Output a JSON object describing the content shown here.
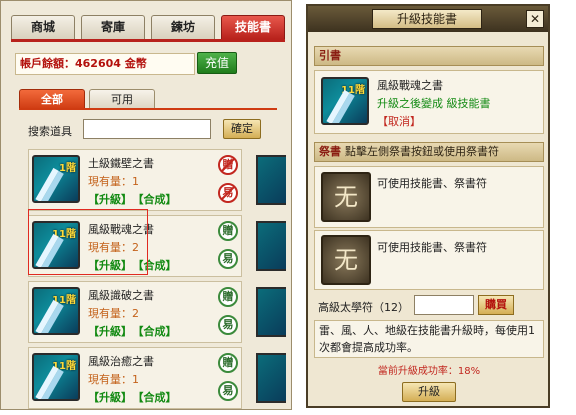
{
  "left": {
    "tabs": [
      "商城",
      "寄庫",
      "鍊坊",
      "技能書"
    ],
    "account_label": "帳戶餘額：462604 金幣",
    "recharge_label": "充值",
    "subtabs": [
      "全部",
      "可用"
    ],
    "search_label": "搜索道具",
    "search_value": "",
    "confirm_label": "確定",
    "items": [
      {
        "level": "1階",
        "name": "土級鐵壁之書",
        "qty": "現有量：1",
        "upgrade": "【升級】",
        "combine": "【合成】",
        "icon1": "贈",
        "icon2": "易",
        "icons_disabled": true
      },
      {
        "level": "11階",
        "name": "風級戰魂之書",
        "qty": "現有量：2",
        "upgrade": "【升級】",
        "combine": "【合成】",
        "icon1": "贈",
        "icon2": "易",
        "icons_disabled": false
      },
      {
        "level": "11階",
        "name": "風級識破之書",
        "qty": "現有量：2",
        "upgrade": "【升級】",
        "combine": "【合成】",
        "icon1": "贈",
        "icon2": "易",
        "icons_disabled": false
      },
      {
        "level": "11階",
        "name": "風級治癒之書",
        "qty": "現有量：1",
        "upgrade": "【升級】",
        "combine": "【合成】",
        "icon1": "贈",
        "icon2": "易",
        "icons_disabled": false
      }
    ]
  },
  "right": {
    "title": "升級技能書",
    "close": "✕",
    "section_book": "引書",
    "book": {
      "level": "11階",
      "name": "風級戰魂之書",
      "after": "升級之後變成  級技能書",
      "cancel": "【取消】"
    },
    "section_sacrifice": "祭書",
    "section_sacrifice_hint": "點擊左側祭書按鈕或使用祭書符",
    "runes": [
      {
        "glyph": "无",
        "text": "可使用技能書、祭書符"
      },
      {
        "glyph": "无",
        "text": "可使用技能書、祭書符"
      }
    ],
    "charm_label": "高級太學符（12）",
    "charm_value": "",
    "buy_label": "購買",
    "description": "雷、風、人、地級在技能書升級時，每使用1次都會提高成功率。",
    "rate": "當前升級成功率：18%",
    "upgrade_label": "升級"
  },
  "colors": {
    "accent_red": "#b8221c",
    "green": "#128a12",
    "orange": "#c4621a"
  }
}
